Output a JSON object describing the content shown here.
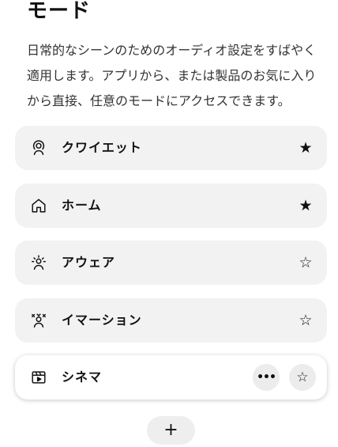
{
  "header": {
    "title": "モード",
    "description_lines": [
      "日常的なシーンのためのオーディオ設定をすばやく",
      "適用します。アプリから、または製品のお気に入り",
      "から直接、任意のモードにアクセスできます。"
    ]
  },
  "modes": [
    {
      "label": "クワイエット",
      "icon": "quiet-person-icon",
      "favorite": true,
      "favorite_glyph": "★"
    },
    {
      "label": "ホーム",
      "icon": "home-icon",
      "favorite": true,
      "favorite_glyph": "★"
    },
    {
      "label": "アウェア",
      "icon": "aware-person-icon",
      "favorite": false,
      "favorite_glyph": "☆"
    },
    {
      "label": "イマーション",
      "icon": "immersion-person-icon",
      "favorite": false,
      "favorite_glyph": "☆"
    },
    {
      "label": "シネマ",
      "icon": "cinema-clapper-icon",
      "favorite": false,
      "favorite_glyph": "☆",
      "more_glyph": "•••"
    }
  ],
  "add_button": {
    "glyph": "+"
  },
  "colors": {
    "item_bg": "#f2f2f2",
    "selected_item_bg": "#ffffff",
    "text": "#111111"
  }
}
